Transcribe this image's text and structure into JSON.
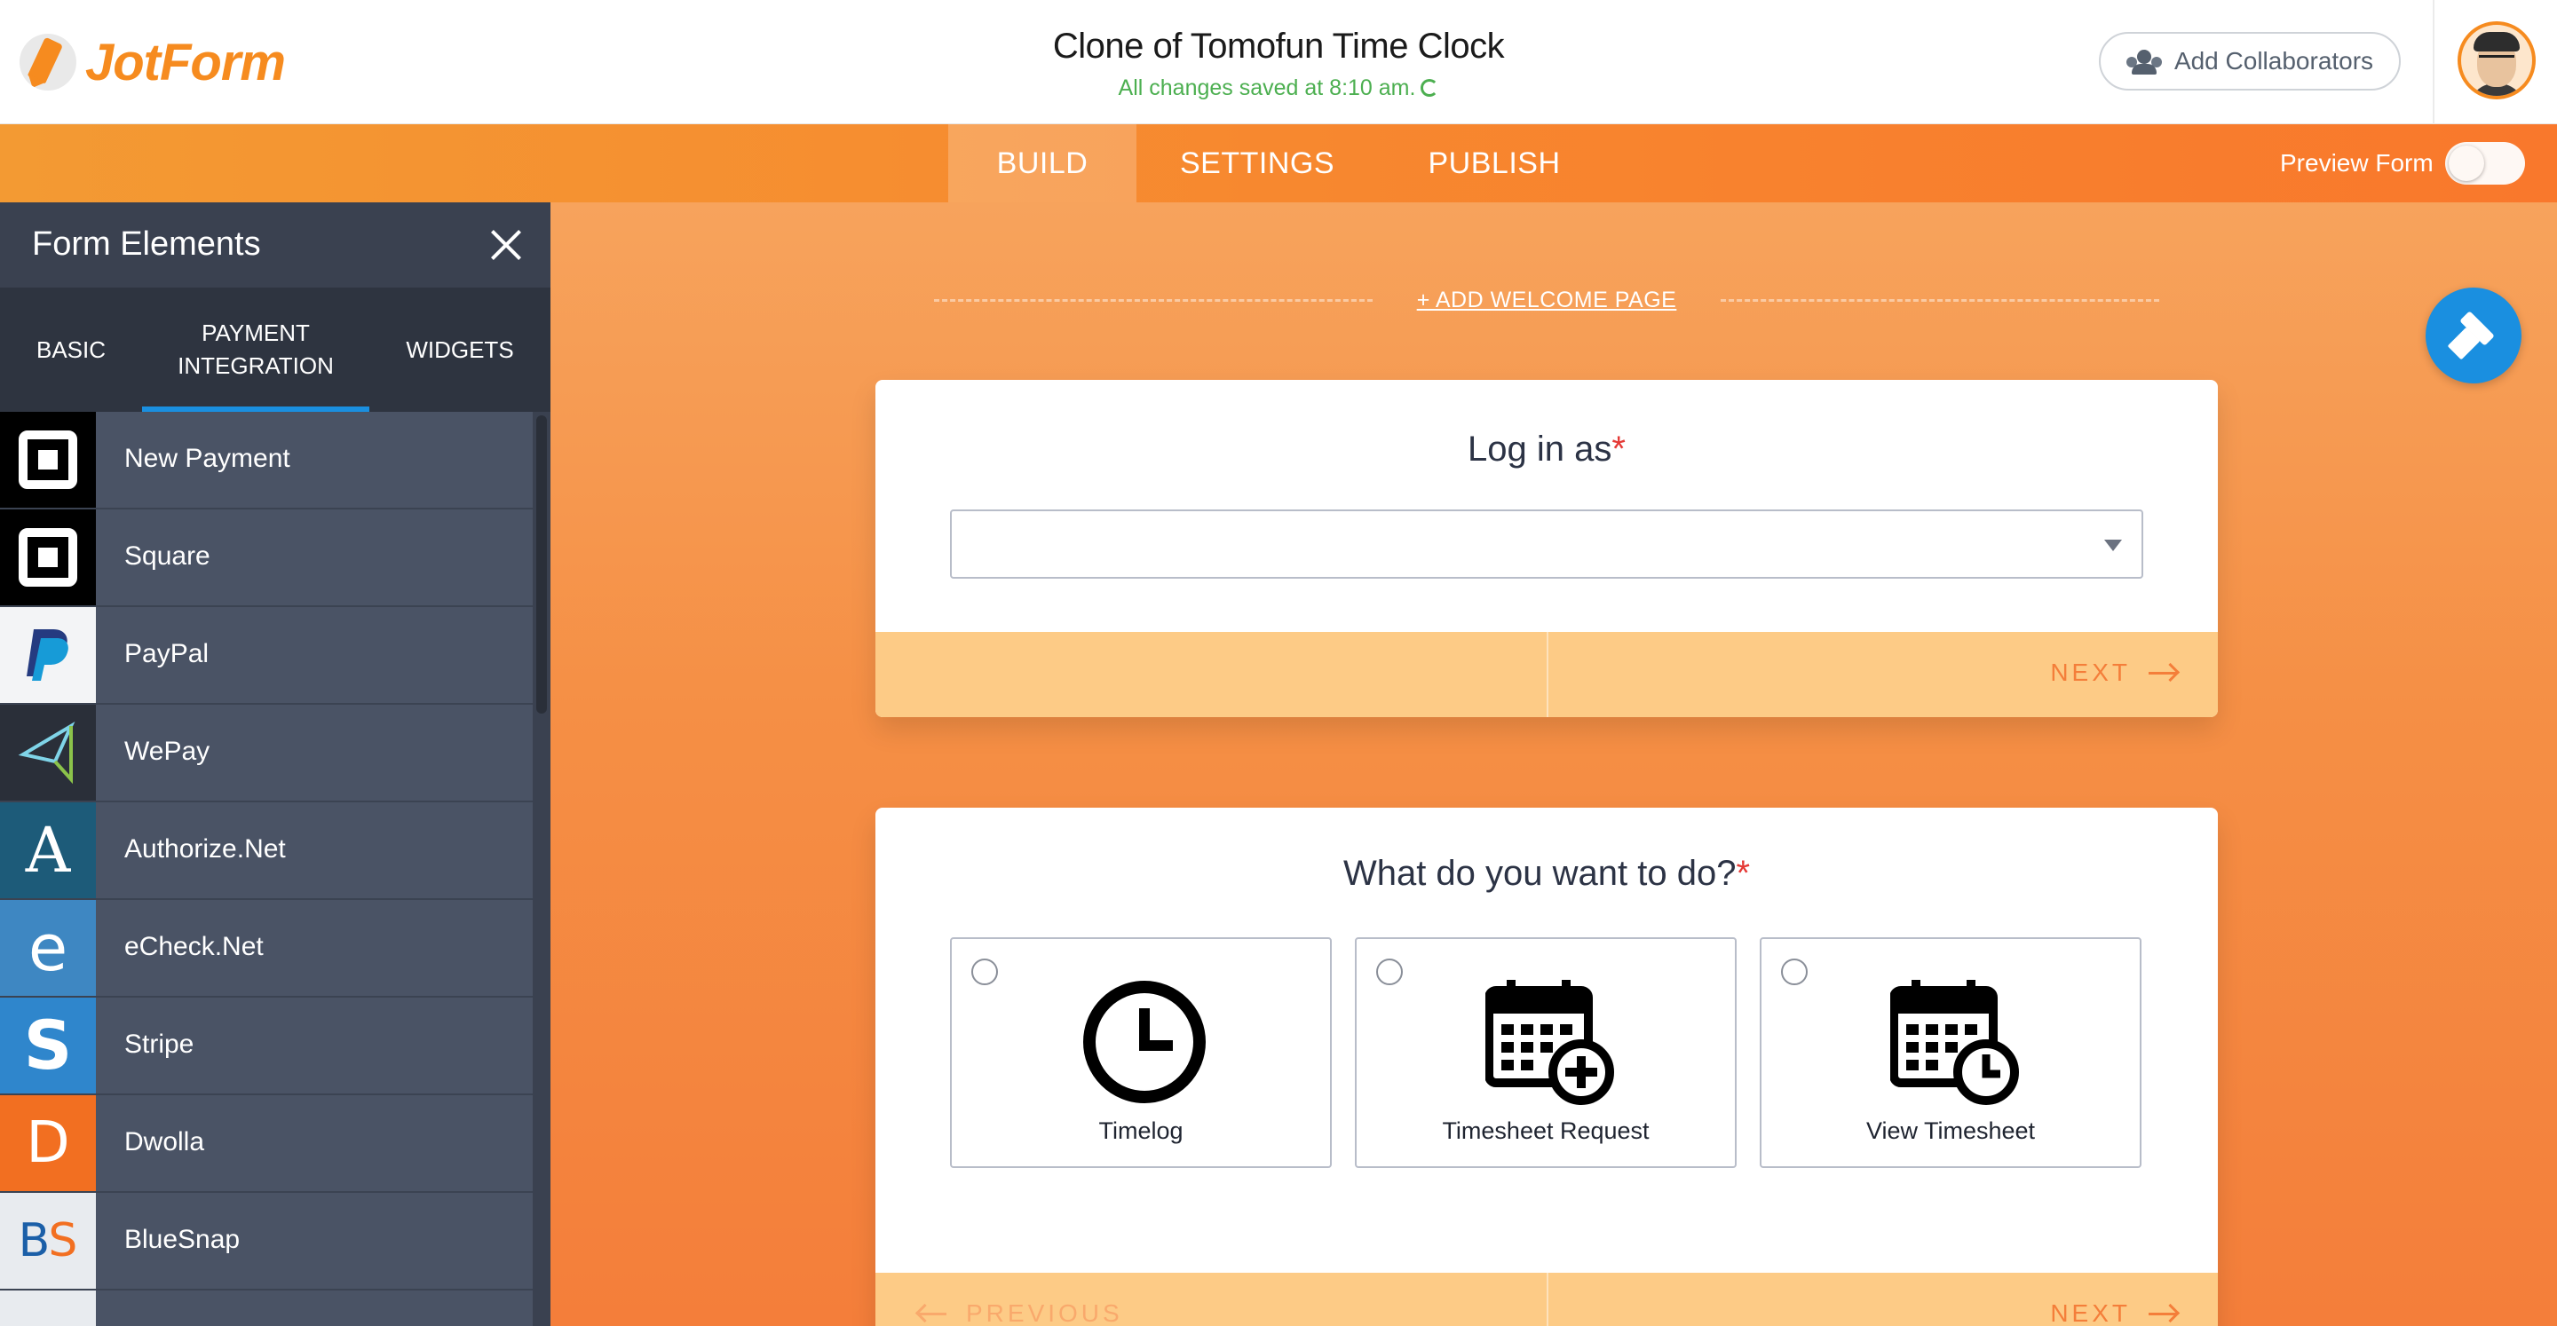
{
  "header": {
    "logo_text": "JotForm",
    "form_title": "Clone of Tomofun Time Clock",
    "save_status": "All changes saved at 8:10 am.",
    "collaborators_label": "Add Collaborators"
  },
  "nav": {
    "tabs": [
      {
        "label": "BUILD",
        "active": true
      },
      {
        "label": "SETTINGS",
        "active": false
      },
      {
        "label": "PUBLISH",
        "active": false
      }
    ],
    "preview_label": "Preview Form",
    "preview_on": false
  },
  "sidebar": {
    "title": "Form Elements",
    "tabs": [
      {
        "label": "BASIC",
        "active": false
      },
      {
        "label": "PAYMENT INTEGRATION",
        "active": true
      },
      {
        "label": "WIDGETS",
        "active": false
      }
    ],
    "items": [
      {
        "label": "New Payment",
        "icon": "square-icon"
      },
      {
        "label": "Square",
        "icon": "square-icon"
      },
      {
        "label": "PayPal",
        "icon": "paypal-icon"
      },
      {
        "label": "WePay",
        "icon": "wepay-icon"
      },
      {
        "label": "Authorize.Net",
        "icon": "authorize-net-icon"
      },
      {
        "label": "eCheck.Net",
        "icon": "echeck-icon"
      },
      {
        "label": "Stripe",
        "icon": "stripe-icon"
      },
      {
        "label": "Dwolla",
        "icon": "dwolla-icon"
      },
      {
        "label": "BlueSnap",
        "icon": "bluesnap-icon"
      }
    ]
  },
  "canvas": {
    "welcome_label": "+ ADD WELCOME PAGE",
    "question1": {
      "label": "Log in as",
      "required_mark": "*",
      "dropdown_value": "",
      "next_label": "NEXT"
    },
    "question2": {
      "label": "What do you want to do?",
      "required_mark": "*",
      "options": [
        {
          "label": "Timelog",
          "icon": "clock-icon"
        },
        {
          "label": "Timesheet Request",
          "icon": "calendar-add-icon"
        },
        {
          "label": "View Timesheet",
          "icon": "calendar-clock-icon"
        }
      ],
      "previous_label": "PREVIOUS",
      "next_label": "NEXT"
    }
  },
  "colors": {
    "brand_orange": "#f68b1f",
    "accent_blue": "#1a8fe0",
    "sidebar_bg": "#3e4554",
    "footer_bar": "#fdcb86",
    "save_green": "#4caf50",
    "required_red": "#e53935"
  }
}
